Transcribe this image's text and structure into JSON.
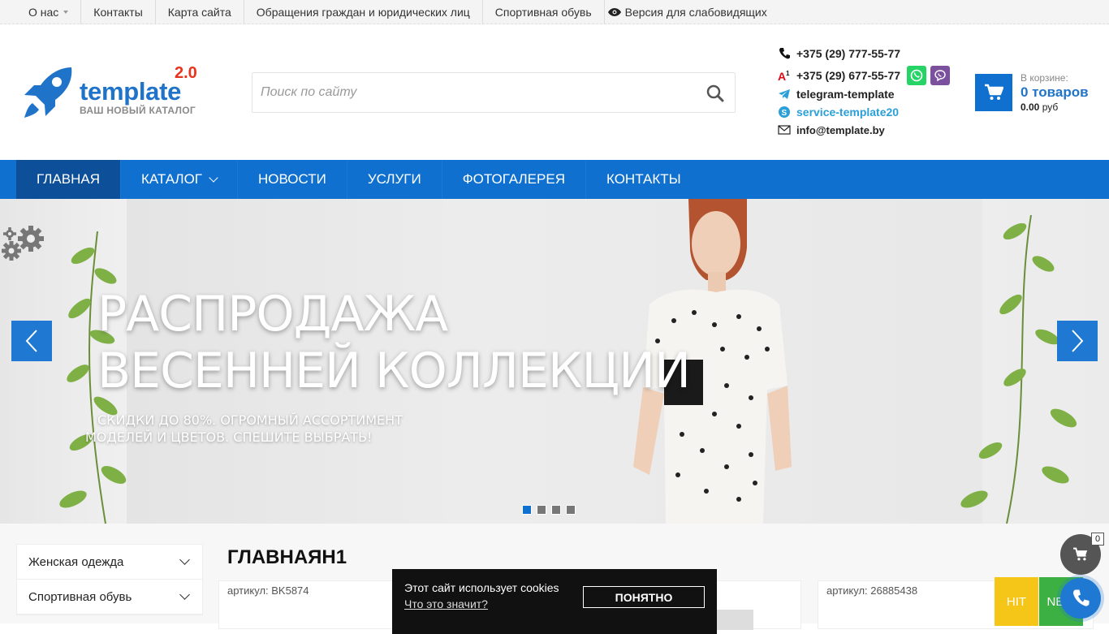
{
  "topbar": {
    "items": [
      "О нас",
      "Контакты",
      "Карта сайта",
      "Обращения граждан и юридических лиц",
      "Спортивная обувь",
      "Версия для слабовидящих"
    ]
  },
  "logo": {
    "version": "2.0",
    "name": "template",
    "tagline": "ВАШ НОВЫЙ КАТАЛОГ"
  },
  "search": {
    "placeholder": "Поиск по сайту"
  },
  "contacts": {
    "phone1": "+375 (29) 777-55-77",
    "phone2": "+375 (29) 677-55-77",
    "telegram": "telegram-template",
    "skype": "service-template20",
    "email": "info@template.by"
  },
  "cart": {
    "label": "В корзине:",
    "items": "0 товаров",
    "sum": "0.00",
    "currency": "руб"
  },
  "nav": {
    "items": [
      "Главная",
      "Каталог",
      "Новости",
      "Услуги",
      "Фотогалерея",
      "Контакты"
    ]
  },
  "slider": {
    "title_line1": "Распродажа",
    "title_line2": "весенней коллекции",
    "sub_line1": "Скидки до 80%. Огромный ассортимент",
    "sub_line2": "моделей и цветов. Спешите выбрать!",
    "slides": 4,
    "active": 1
  },
  "sidebar": {
    "items": [
      "Женская одежда",
      "Спортивная обувь"
    ]
  },
  "page_title": "ГЛАВНАЯН1",
  "products": [
    {
      "article": "артикул: BK5874"
    },
    {
      "article": "артикул: 26885438"
    }
  ],
  "badges": {
    "hit": "HIT",
    "new": "NEW"
  },
  "cookie": {
    "text": "Этот сайт использует cookies",
    "link": "Что это значит?",
    "button": "Понятно"
  },
  "floating_cart": {
    "count": "0"
  },
  "colors": {
    "primary": "#1070cf",
    "nav_active": "#0d4f99",
    "hit": "#f5c518",
    "new": "#3cb043",
    "whatsapp": "#25d366",
    "viber": "#7b519d"
  }
}
